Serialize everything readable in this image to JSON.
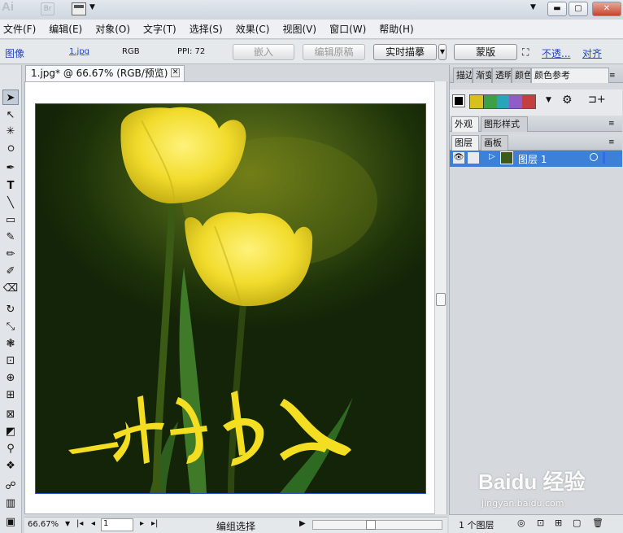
{
  "app": {
    "logo": "Ai",
    "bridge": "Br"
  },
  "window": {
    "min": "▬",
    "max": "▢",
    "close": "✕"
  },
  "menu": [
    "文件(F)",
    "编辑(E)",
    "对象(O)",
    "文字(T)",
    "选择(S)",
    "效果(C)",
    "视图(V)",
    "窗口(W)",
    "帮助(H)"
  ],
  "control": {
    "type_label": "图像",
    "file_link": "1.jpg",
    "mode": "RGB",
    "ppi": "PPI: 72",
    "embed": "嵌入",
    "edit_original": "编辑原稿",
    "live_trace": "实时描摹",
    "mask": "蒙版",
    "opacity_link": "不透...",
    "align_link": "对齐"
  },
  "document": {
    "tab_title": "1.jpg* @ 66.67% (RGB/预览)",
    "artwork_text": "黄色花朵"
  },
  "status": {
    "zoom": "66.67%",
    "page": "1",
    "tool": "编组选择"
  },
  "panels": {
    "top_tabs": [
      "描边",
      "渐变",
      "透明",
      "颜色",
      "颜色参考"
    ],
    "appearance_tab": "外观",
    "graphic_styles_tab": "图形样式",
    "layers_tab": "图层",
    "artboards_tab": "画板",
    "layer_name": "图层 1",
    "layer_count": "1 个图层",
    "guide_colors": [
      "#d6c21a",
      "#3e9f4b",
      "#29a5b9",
      "#8f5cc8",
      "#c44040"
    ]
  },
  "watermark": {
    "main": "Baidu 经验",
    "sub": "jingyan.baidu.com"
  }
}
